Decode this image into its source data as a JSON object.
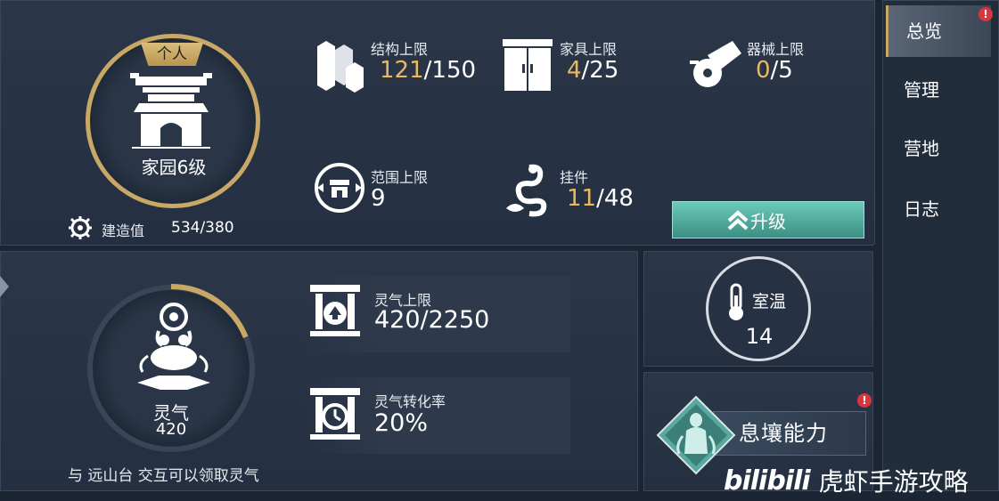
{
  "home": {
    "tag": "个人",
    "level_label": "家园6级",
    "build_label": "建造值",
    "build_value": "534/380"
  },
  "stats": {
    "structure": {
      "label": "结构上限",
      "current": "121",
      "max": "/150"
    },
    "furniture": {
      "label": "家具上限",
      "current": "4",
      "max": "/25"
    },
    "equipment": {
      "label": "器械上限",
      "current": "0",
      "max": "/5"
    },
    "range": {
      "label": "范围上限",
      "value": "9"
    },
    "pendant": {
      "label": "挂件",
      "current": "11",
      "max": "/48"
    }
  },
  "upgrade_button": {
    "label": "升级"
  },
  "spirit": {
    "name": "灵气",
    "value": "420",
    "progress": 0.19,
    "hint": "与 远山台 交互可以领取灵气",
    "cap_label": "灵气上限",
    "cap_value": "420/2250",
    "rate_label": "灵气转化率",
    "rate_value": "20%"
  },
  "temperature": {
    "label": "室温",
    "value": "14"
  },
  "ability": {
    "label": "息壤能力",
    "alert": "!"
  },
  "tabs": [
    {
      "label": "总览",
      "active": true,
      "alert": "!"
    },
    {
      "label": "管理"
    },
    {
      "label": "营地"
    },
    {
      "label": "日志"
    }
  ],
  "watermark": {
    "logo": "bilibili",
    "text": "虎虾手游攻略"
  },
  "colors": {
    "gold": "#e8b864",
    "accent_teal": "#4fae9e",
    "alert_red": "#d7363c"
  }
}
